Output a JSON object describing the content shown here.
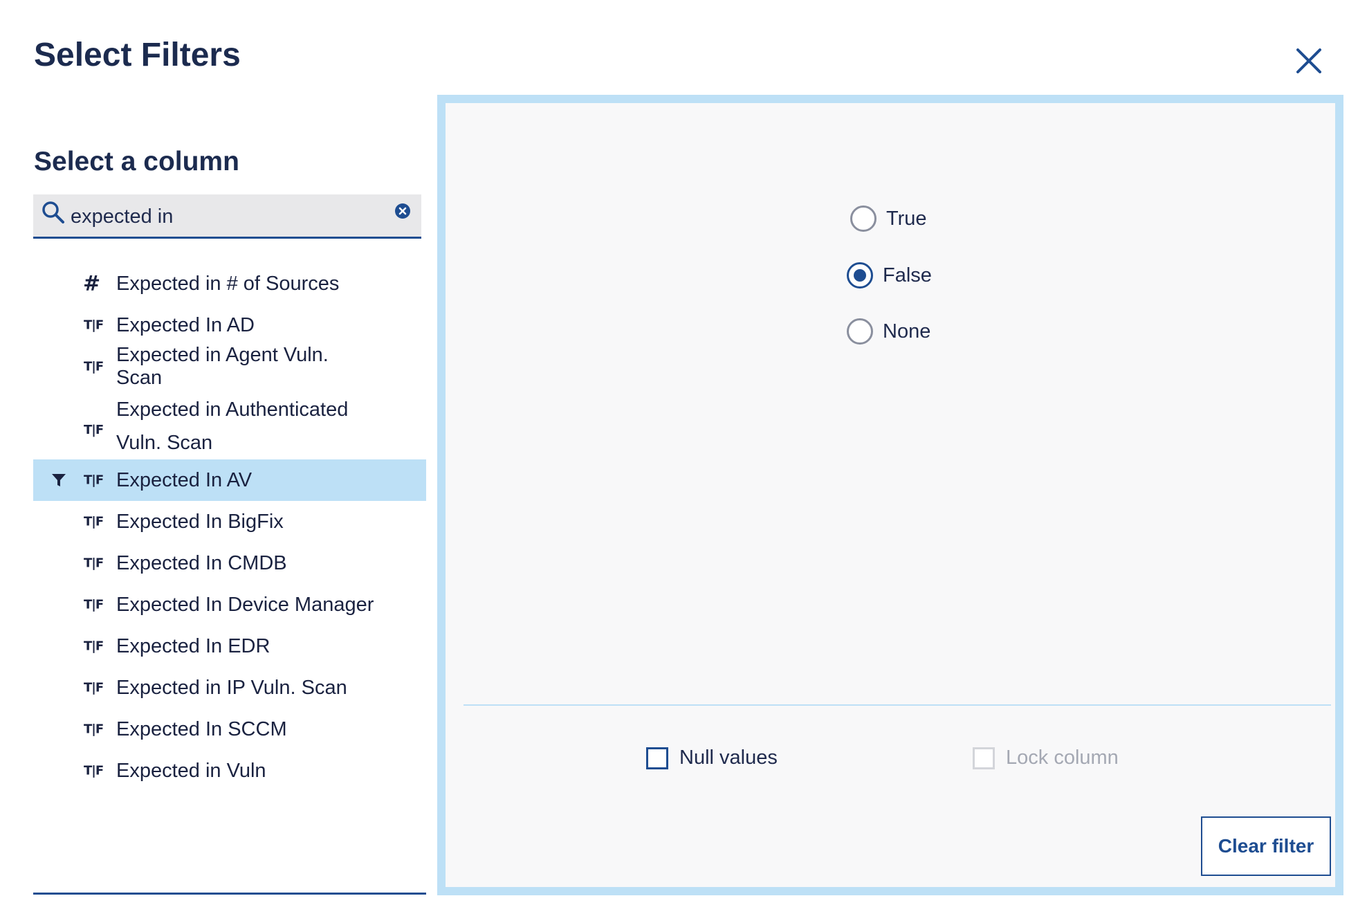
{
  "dialog": {
    "title": "Select Filters",
    "close_icon": "close-icon"
  },
  "column_picker": {
    "heading": "Select a column",
    "search": {
      "value": "expected in",
      "placeholder": ""
    },
    "items": [
      {
        "label": "Expected in # of Sources",
        "type_icon": "#",
        "selected": false
      },
      {
        "label": "Expected In AD",
        "type_icon": "T|F",
        "selected": false
      },
      {
        "label": "Expected in Agent Vuln. Scan",
        "type_icon": "T|F",
        "selected": false
      },
      {
        "label": "Expected in Authenticated Vuln. Scan",
        "type_icon": "T|F",
        "selected": false
      },
      {
        "label": "Expected In AV",
        "type_icon": "T|F",
        "selected": true
      },
      {
        "label": "Expected In BigFix",
        "type_icon": "T|F",
        "selected": false
      },
      {
        "label": "Expected In CMDB",
        "type_icon": "T|F",
        "selected": false
      },
      {
        "label": "Expected In Device Manager",
        "type_icon": "T|F",
        "selected": false
      },
      {
        "label": "Expected In EDR",
        "type_icon": "T|F",
        "selected": false
      },
      {
        "label": "Expected in IP Vuln. Scan",
        "type_icon": "T|F",
        "selected": false
      },
      {
        "label": "Expected In SCCM",
        "type_icon": "T|F",
        "selected": false
      },
      {
        "label": "Expected in Vuln",
        "type_icon": "T|F",
        "selected": false
      }
    ]
  },
  "filter_panel": {
    "options": [
      {
        "label": "True",
        "checked": false
      },
      {
        "label": "False",
        "checked": true
      },
      {
        "label": "None",
        "checked": false
      }
    ],
    "null_values_label": "Null values",
    "lock_column_label": "Lock column",
    "clear_filter_label": "Clear filter"
  },
  "colors": {
    "accent": "#1e4d91",
    "highlight": "#bde0f6",
    "text": "#1c2b4f"
  }
}
